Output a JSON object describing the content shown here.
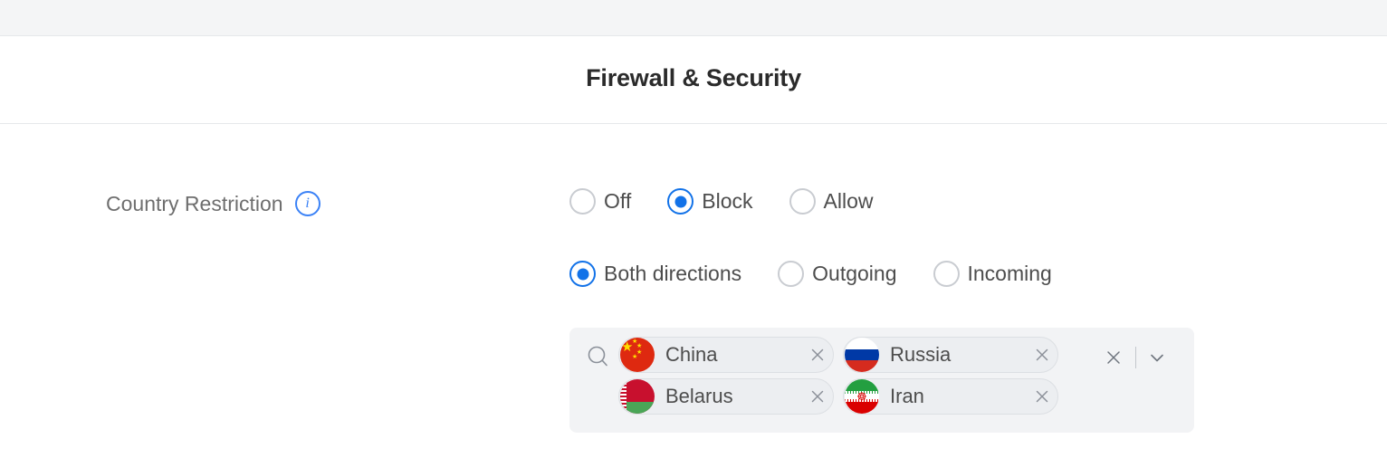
{
  "header": {
    "title": "Firewall & Security"
  },
  "field": {
    "label": "Country Restriction",
    "info_icon": "info-icon",
    "info_glyph": "i"
  },
  "mode_radios": {
    "name": "country-restriction-mode",
    "options": [
      {
        "label": "Off",
        "selected": false
      },
      {
        "label": "Block",
        "selected": true
      },
      {
        "label": "Allow",
        "selected": false
      }
    ]
  },
  "direction_radios": {
    "name": "country-restriction-direction",
    "options": [
      {
        "label": "Both directions",
        "selected": true
      },
      {
        "label": "Outgoing",
        "selected": false
      },
      {
        "label": "Incoming",
        "selected": false
      }
    ]
  },
  "country_select": {
    "search_icon": "search-icon",
    "clear_all_icon": "close-icon",
    "dropdown_icon": "chevron-down-icon",
    "chip_remove_icon": "close-icon",
    "chips": [
      {
        "name": "China",
        "flag": "cn"
      },
      {
        "name": "Russia",
        "flag": "ru"
      },
      {
        "name": "Belarus",
        "flag": "by"
      },
      {
        "name": "Iran",
        "flag": "ir"
      }
    ]
  },
  "colors": {
    "accent_blue": "#1272e8",
    "info_blue": "#3b82f6",
    "label_gray": "#6e6e6e",
    "text_gray": "#4d4d4d",
    "panel_gray": "#f2f3f5",
    "chip_gray": "#eceef1",
    "strip_gray": "#f4f5f6",
    "border_gray": "#e6e8ea"
  }
}
